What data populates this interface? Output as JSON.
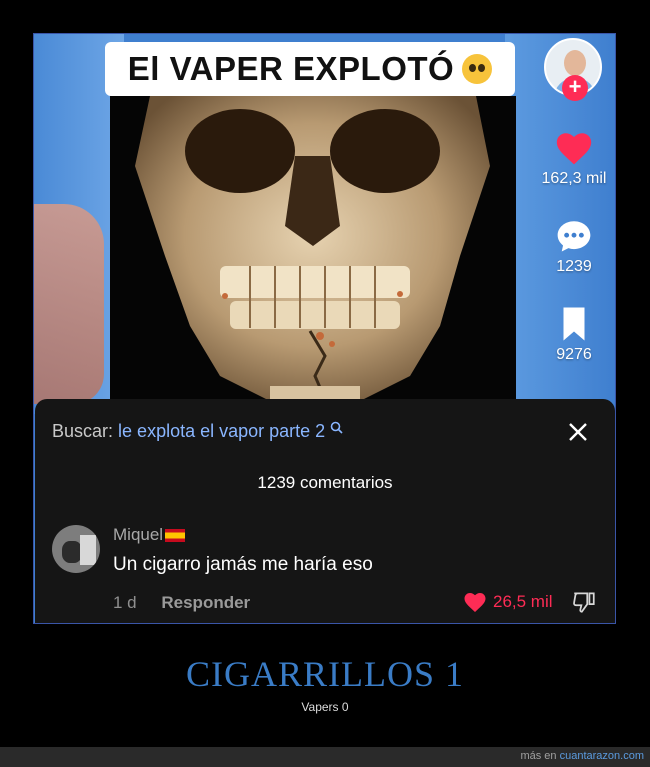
{
  "video": {
    "title": "El VAPER EXPLOTÓ",
    "emoji_icon": "pleading-face-emoji",
    "likes_count": "162,3 mil",
    "comments_count": "1239",
    "saves_count": "9276"
  },
  "comments_sheet": {
    "search_label": "Buscar:",
    "search_query": "le explota el vapor parte 2",
    "total_label": "1239 comentarios",
    "comment": {
      "author": "Miquel",
      "text": "Un cigarro jamás me haría eso",
      "time": "1 d",
      "reply_label": "Responder",
      "likes": "26,5 mil"
    }
  },
  "caption": {
    "title": "CIGARRILLOS 1",
    "subtitle": "Vapers 0"
  },
  "footer": {
    "prefix": "más en",
    "site": "cuantarazon.com"
  },
  "colors": {
    "accent_red": "#fe2c55",
    "caption_blue": "#3a7cc6",
    "search_blue": "#8ab6ff"
  }
}
